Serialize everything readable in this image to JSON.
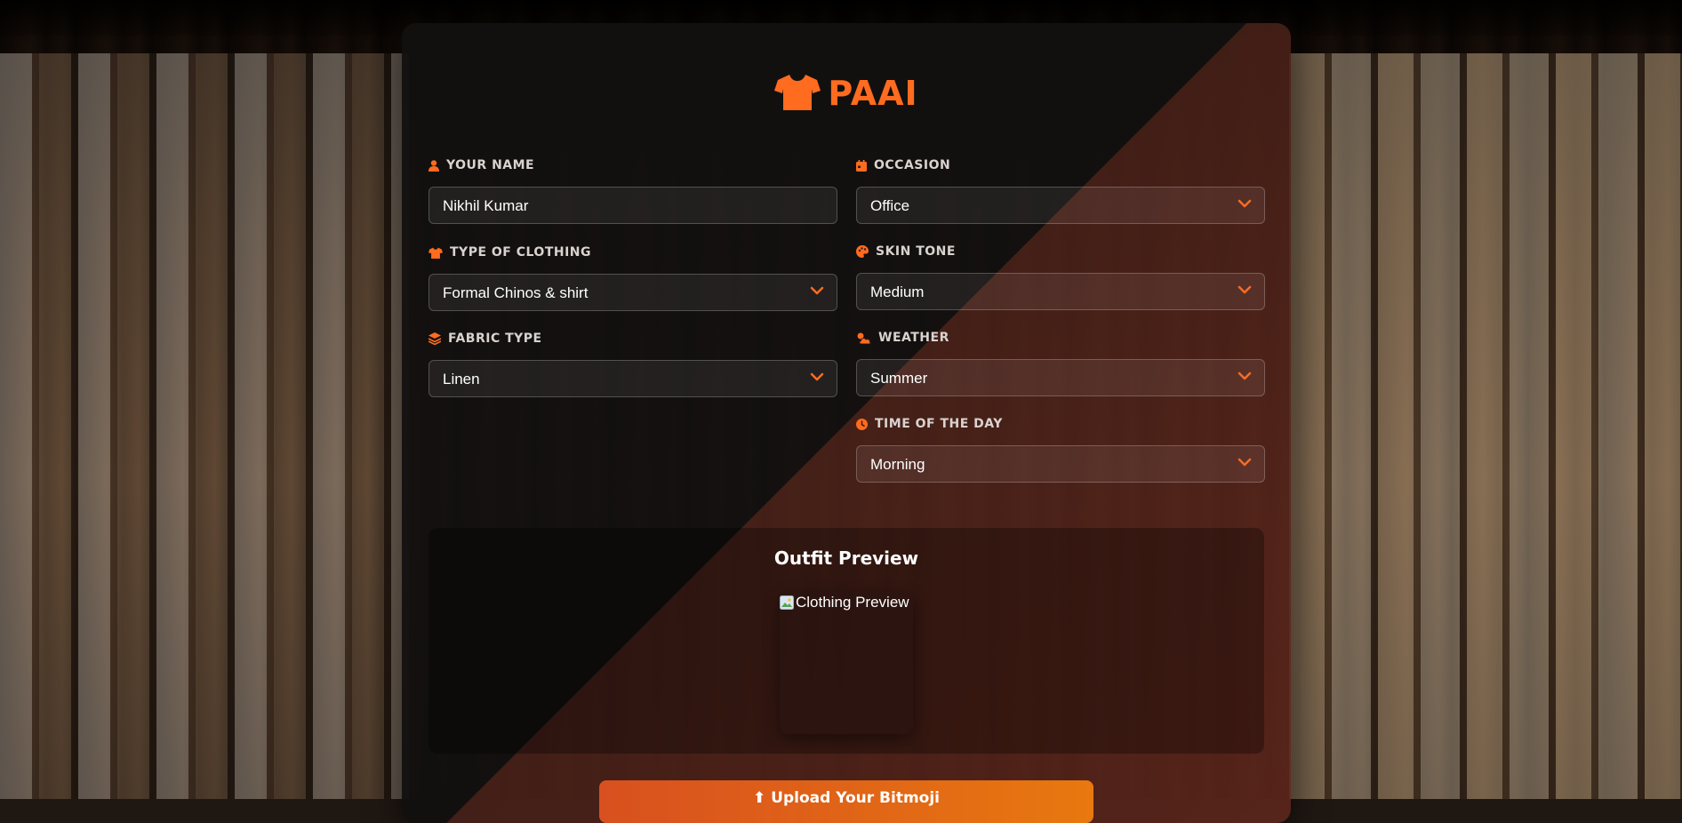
{
  "brand": {
    "name": "PAAI",
    "color": "#ff6b1f",
    "icon": "tshirt-icon"
  },
  "fields": {
    "name": {
      "label": "YOUR NAME",
      "value": "Nikhil Kumar",
      "icon": "user-icon"
    },
    "occasion": {
      "label": "OCCASION",
      "value": "Office",
      "icon": "calendar-icon"
    },
    "clothing": {
      "label": "TYPE OF CLOTHING",
      "value": "Formal Chinos & shirt",
      "icon": "tshirt-icon"
    },
    "skin_tone": {
      "label": "SKIN TONE",
      "value": "Medium",
      "icon": "palette-icon"
    },
    "fabric": {
      "label": "FABRIC TYPE",
      "value": "Linen",
      "icon": "layers-icon"
    },
    "weather": {
      "label": "WEATHER",
      "value": "Summer",
      "icon": "cloud-sun-icon"
    },
    "time": {
      "label": "TIME OF THE DAY",
      "value": "Morning",
      "icon": "clock-icon"
    }
  },
  "preview": {
    "title": "Outfit Preview",
    "image_alt": "Clothing Preview"
  },
  "upload": {
    "label": "⬆ Upload Your Bitmoji"
  },
  "colors": {
    "accent": "#ff6b1f",
    "card_dark": "#12100f",
    "card_warm": "#5f261c"
  }
}
